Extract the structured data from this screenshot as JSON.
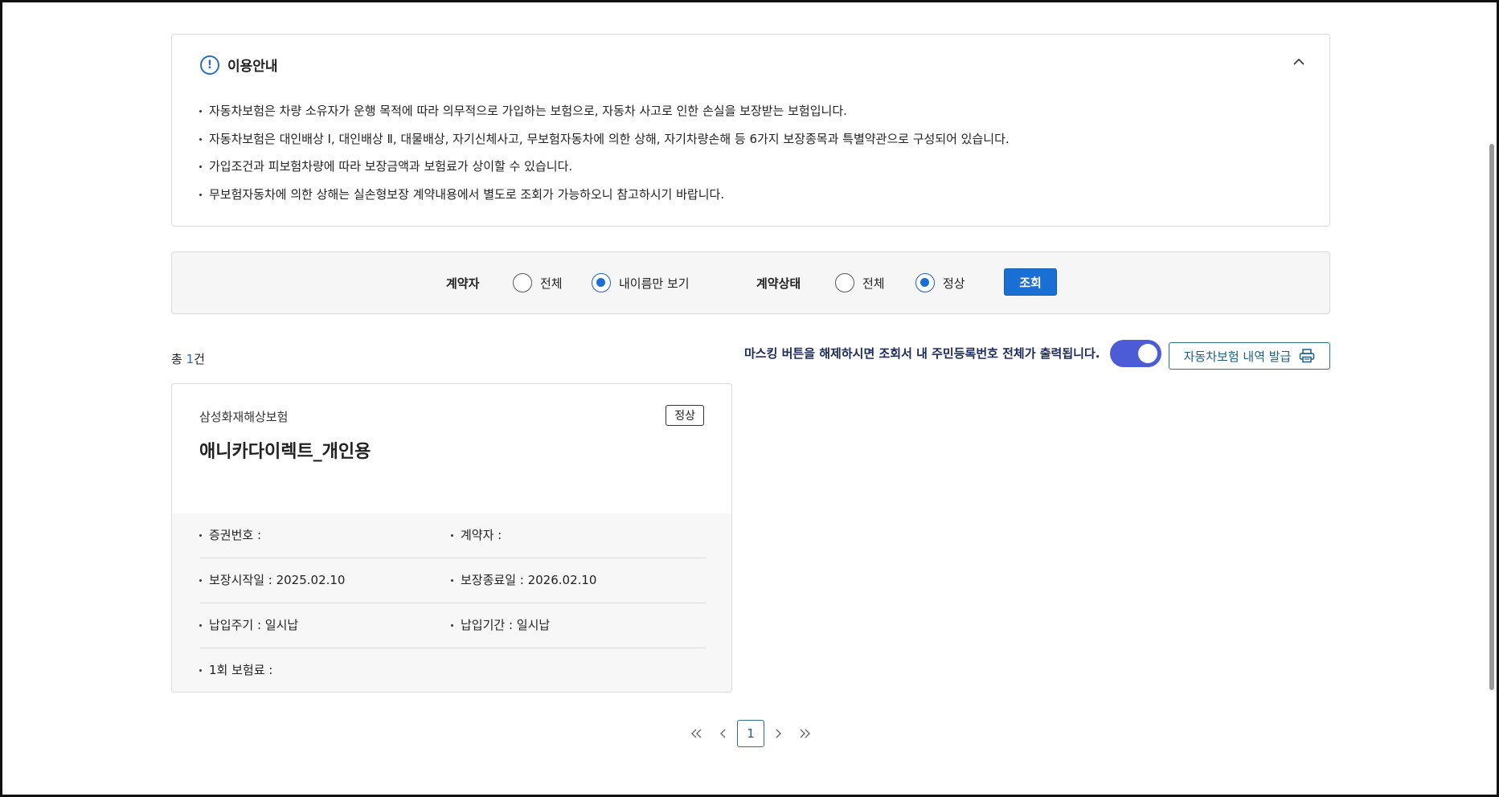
{
  "notice": {
    "title": "이용안내",
    "items": [
      "자동차보험은 차량 소유자가 운행 목적에 따라 의무적으로 가입하는 보험으로, 자동차 사고로 인한 손실을 보장받는 보험입니다.",
      "자동차보험은 대인배상 Ⅰ, 대인배상 Ⅱ, 대물배상, 자기신체사고, 무보험자동차에 의한 상해, 자기차량손해 등 6가지 보장종목과 특별약관으로 구성되어 있습니다.",
      "가입조건과 피보험차량에 따라 보장금액과 보험료가 상이할 수 있습니다.",
      "무보험자동차에 의한 상해는 실손형보장 계약내용에서 별도로 조회가 가능하오니 참고하시기 바랍니다."
    ]
  },
  "filter": {
    "contractor_label": "계약자",
    "contractor_options": [
      "전체",
      "내이름만 보기"
    ],
    "status_label": "계약상태",
    "status_options": [
      "전체",
      "정상"
    ],
    "search_button": "조회"
  },
  "summary": {
    "total_prefix": "총 ",
    "total_count": "1",
    "total_suffix": "건",
    "mask_message": "마스킹 버튼을 해제하시면 조회서 내 주민등록번호 전체가 출력됩니다.",
    "issue_button": "자동차보험 내역 발급"
  },
  "card": {
    "company": "삼성화재해상보험",
    "status": "정상",
    "product": "애니카다이렉트_개인용",
    "fields": {
      "policy_no": "증권번호 :",
      "contractor": "계약자 :",
      "start_date": "보장시작일 : 2025.02.10",
      "end_date": "보장종료일 : 2026.02.10",
      "pay_cycle": "납입주기 : 일시납",
      "pay_period": "납입기간 : 일시납",
      "premium": "1회 보험료 :"
    }
  },
  "pagination": {
    "current_page": "1"
  },
  "colors": {
    "accent": "#1a6fd4",
    "toggle": "#4c5bd6",
    "outline": "#2b6f8a"
  }
}
